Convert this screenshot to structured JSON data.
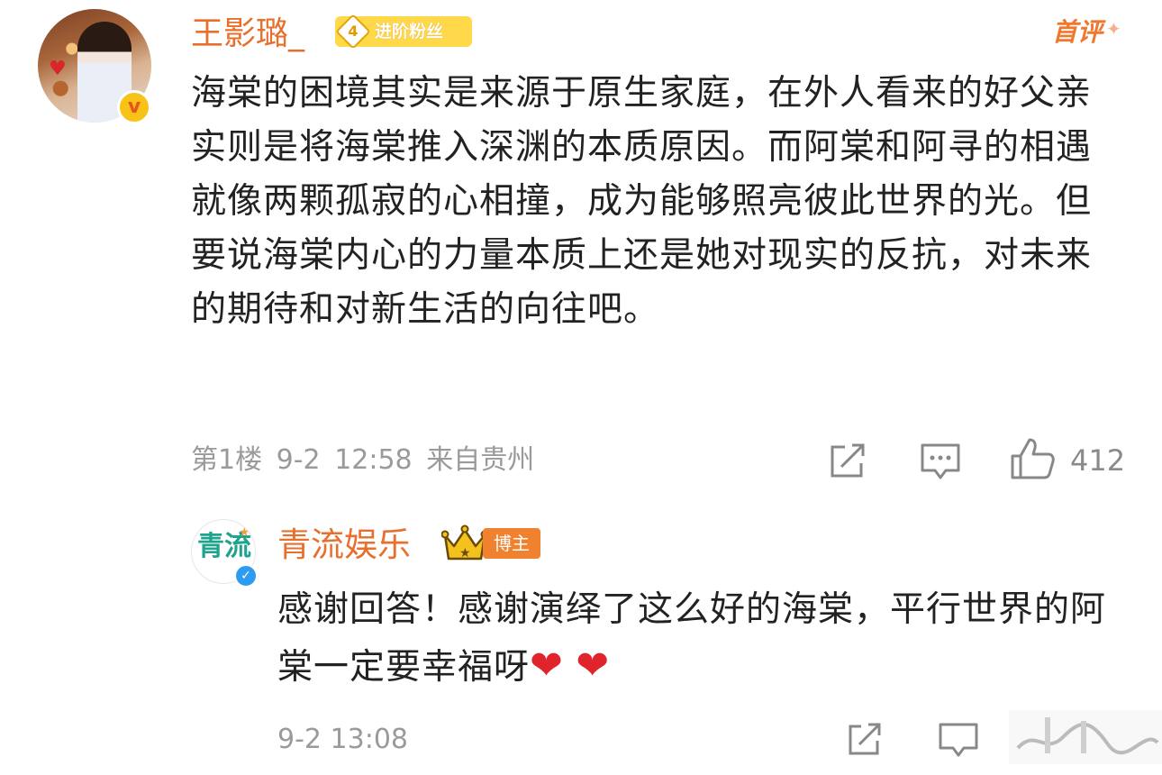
{
  "comment1": {
    "username": "王影璐_",
    "fan_badge": {
      "level": "4",
      "label": "进阶粉丝"
    },
    "first_badge": "首评",
    "text": "海棠的困境其实是来源于原生家庭，在外人看来的好父亲实则是将海棠推入深渊的本质原因。而阿棠和阿寻的相遇就像两颗孤寂的心相撞，成为能够照亮彼此世界的光。但要说海棠内心的力量本质上还是她对现实的反抗，对未来的期待和对新生活的向往吧。",
    "floor": "第1楼",
    "date": "9-2",
    "time": "12:58",
    "location": "来自贵州",
    "like_count": "412",
    "icons": [
      "share-icon",
      "comment-icon",
      "like-icon"
    ]
  },
  "reply": {
    "avatar_logo": "青流",
    "username": "青流娱乐",
    "host_badge": "博主",
    "text": "感谢回答！感谢演绎了这么好的海棠，平行世界的阿棠一定要幸福呀",
    "emoji": [
      "❤",
      "❤"
    ],
    "date": "9-2",
    "time": "13:08"
  },
  "colors": {
    "username": "#e86f2c",
    "body_text": "#222222",
    "meta_text": "#9a9a9a",
    "fan_badge_bg": "#ffd94a",
    "host_badge_bg": "#f0812f",
    "heart": "#e0242c"
  }
}
